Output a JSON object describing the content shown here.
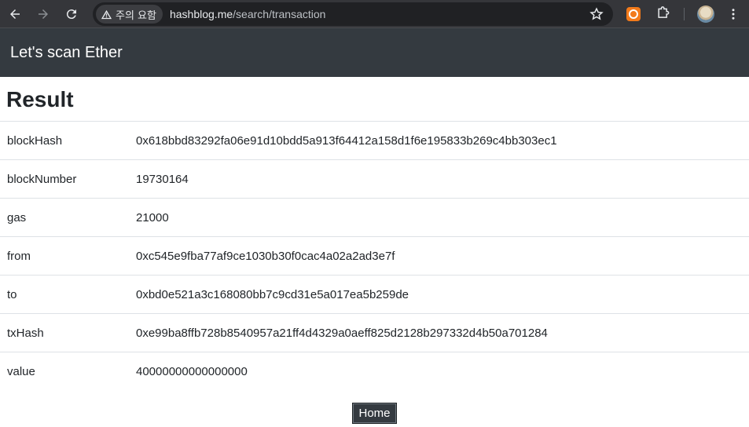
{
  "browser": {
    "security_label": "주의 요함",
    "url_host": "hashblog.me",
    "url_path": "/search/transaction"
  },
  "navbar": {
    "brand": "Let's scan Ether"
  },
  "result": {
    "title": "Result",
    "rows": [
      {
        "key": "blockHash",
        "value": "0x618bbd83292fa06e91d10bdd5a913f64412a158d1f6e195833b269c4bb303ec1"
      },
      {
        "key": "blockNumber",
        "value": "19730164"
      },
      {
        "key": "gas",
        "value": "21000"
      },
      {
        "key": "from",
        "value": "0xc545e9fba77af9ce1030b30f0cac4a02a2ad3e7f"
      },
      {
        "key": "to",
        "value": "0xbd0e521a3c168080bb7c9cd31e5a017ea5b259de"
      },
      {
        "key": "txHash",
        "value": "0xe99ba8ffb728b8540957a21ff4d4329a0aeff825d2128b297332d4b50a701284"
      },
      {
        "key": "value",
        "value": "40000000000000000"
      }
    ]
  },
  "home_button_label": "Home",
  "colors": {
    "navbar_bg": "#343a40",
    "browser_bg": "#35363a"
  }
}
